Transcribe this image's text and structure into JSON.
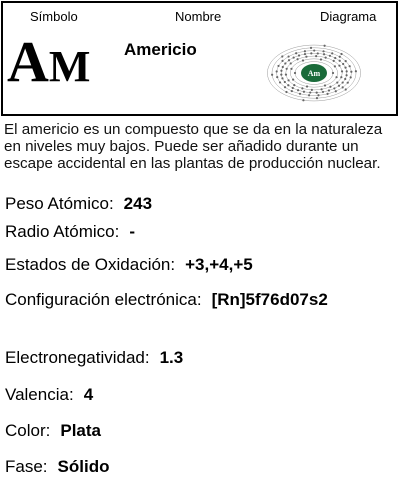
{
  "header": {
    "simbolo_label": "Símbolo",
    "nombre_label": "Nombre",
    "diagrama_label": "Diagrama"
  },
  "element": {
    "symbol_first": "A",
    "symbol_rest": "M",
    "name": "Americio",
    "diagram_nucleus_label": "Am"
  },
  "description": "El americio es un compuesto que se da en la naturaleza en niveles muy bajos. Puede ser añadido durante un escape accidental en las plantas de producción nuclear.",
  "properties": [
    {
      "label": "Peso Atómico:",
      "value": "243"
    },
    {
      "label": "Radio Atómico:",
      "value": "-"
    },
    {
      "label": "Estados de Oxidación:",
      "value": "+3,+4,+5"
    },
    {
      "label": "Configuración electrónica:",
      "value": "[Rn]5f76d07s2"
    },
    {
      "label": "Electronegatividad:",
      "value": "1.3"
    },
    {
      "label": "Valencia:",
      "value": "4"
    },
    {
      "label": "Color:",
      "value": "Plata"
    },
    {
      "label": "Fase:",
      "value": "Sólido"
    }
  ],
  "colors": {
    "nucleus": "#1a6b3a",
    "shells": "#999999",
    "electrons": "#666666"
  }
}
